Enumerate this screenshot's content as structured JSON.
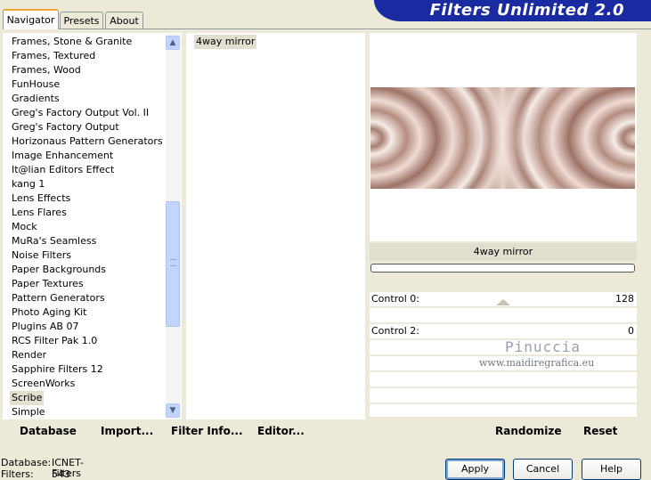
{
  "tabs": [
    {
      "label": "Navigator"
    },
    {
      "label": "Presets"
    },
    {
      "label": "About"
    }
  ],
  "banner": {
    "title": "Filters Unlimited 2.0"
  },
  "categories": [
    "Frames, Stone & Granite",
    "Frames, Textured",
    "Frames, Wood",
    "FunHouse",
    "Gradients",
    "Greg's Factory Output Vol. II",
    "Greg's Factory Output",
    "Horizonaus Pattern Generators",
    "Image Enhancement",
    "It@lian Editors Effect",
    "kang 1",
    "Lens Effects",
    "Lens Flares",
    "Mock",
    "MuRa's Seamless",
    "Noise Filters",
    "Paper Backgrounds",
    "Paper Textures",
    "Pattern Generators",
    "Photo Aging Kit",
    "Plugins AB 07",
    "RCS Filter Pak 1.0",
    "Render",
    "Sapphire Filters 12",
    "ScreenWorks",
    "Scribe",
    "Simple"
  ],
  "selected_category": "Scribe",
  "filters": [
    "4way mirror"
  ],
  "preview": {
    "filter_name": "4way mirror"
  },
  "controls": [
    {
      "label": "Control 0:",
      "value": "128"
    },
    {
      "label": "Control 2:",
      "value": "0"
    }
  ],
  "watermark": {
    "name": "Pinuccia",
    "url": "www.maidiregrafica.eu"
  },
  "actions": {
    "database": "Database",
    "import": "Import...",
    "filter_info": "Filter Info...",
    "editor": "Editor...",
    "randomize": "Randomize",
    "reset": "Reset"
  },
  "status": {
    "database_label": "Database:",
    "database_value": "ICNET-Filters",
    "filters_label": "Filters:",
    "filters_value": "543"
  },
  "buttons": {
    "apply": "Apply",
    "cancel": "Cancel",
    "help": "Help"
  },
  "colors": {
    "banner": "#1a2aa0",
    "selection": "#e2ded0",
    "scrollbar": "#c4d5fd"
  }
}
